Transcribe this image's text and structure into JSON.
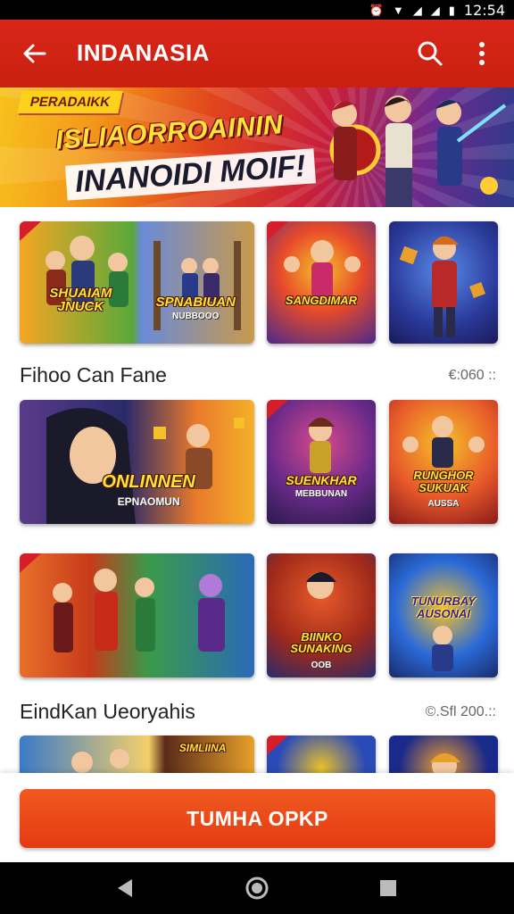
{
  "status_bar": {
    "time": "12:54",
    "icons": [
      "alarm-icon",
      "wifi-icon",
      "signal-icon",
      "signal-icon",
      "battery-icon"
    ]
  },
  "app_bar": {
    "title": "INDANASIA",
    "back_icon": "arrow-left-icon",
    "search_icon": "search-icon",
    "menu_icon": "more-vert-icon",
    "background": "#d9261a"
  },
  "banner": {
    "tag": "PERADAIKK",
    "headline_1": "ISLIAORROAININ",
    "headline_2": "INANOIDI MOIF!"
  },
  "row_1": [
    {
      "title": "SHUAIAM\nJNUCK",
      "colors": [
        "#f5a623",
        "#3a8f3a"
      ]
    },
    {
      "title": "SPNABIUAN",
      "subtitle": "NUBBOOO",
      "colors": [
        "#4a7ab8",
        "#c89a4a"
      ]
    },
    {
      "title": "SANGDIMAR",
      "colors": [
        "#e84a2a",
        "#4a2a8a"
      ]
    },
    {
      "title": "",
      "colors": [
        "#2a5ab8",
        "#e8a02a"
      ]
    }
  ],
  "section_1": {
    "title": "Fihoo Can Fane",
    "meta": "€:060 ::"
  },
  "row_2": [
    {
      "title": "ONLINNEN",
      "subtitle": "EPNAOMUN",
      "colors": [
        "#2a2a6a",
        "#e87a2a"
      ]
    },
    {
      "title": "SUENKHAR",
      "subtitle": "MEBBUNAN",
      "colors": [
        "#4a2a6a",
        "#d84a8a"
      ]
    },
    {
      "title": "RUNGHOR\nSUKUAK",
      "subtitle": "AUSSA",
      "colors": [
        "#e85a2a",
        "#f5c02a"
      ]
    }
  ],
  "row_3": [
    {
      "title": "",
      "colors": [
        "#e8702a",
        "#3a9a4a"
      ]
    },
    {
      "title": "BIINKO\nSUNAKING",
      "subtitle": "OOB",
      "colors": [
        "#c83a1a",
        "#2a5ab8"
      ]
    },
    {
      "title": "TUNURBAY\nAUSONAI",
      "colors": [
        "#2a6ad8",
        "#f5b02a"
      ]
    }
  ],
  "section_2": {
    "title": "EindKan Ueoryahis",
    "meta": "©.Sfl 200.::"
  },
  "row_4": [
    {
      "title": "",
      "colors": [
        "#3a7ac8",
        "#f5d06a"
      ]
    },
    {
      "title": "SIMLIINA",
      "colors": [
        "#5a2a1a",
        "#e8a02a"
      ]
    },
    {
      "title": "",
      "colors": [
        "#2a4ab8",
        "#e8c02a"
      ]
    },
    {
      "title": "",
      "colors": [
        "#1a2a8a",
        "#f5a02a"
      ]
    }
  ],
  "cta": {
    "label": "TUMHA OPKP",
    "color": "#e9441a"
  },
  "nav_bar": {
    "back_icon": "triangle-back-icon",
    "home_icon": "circle-home-icon",
    "recents_icon": "square-recents-icon"
  }
}
